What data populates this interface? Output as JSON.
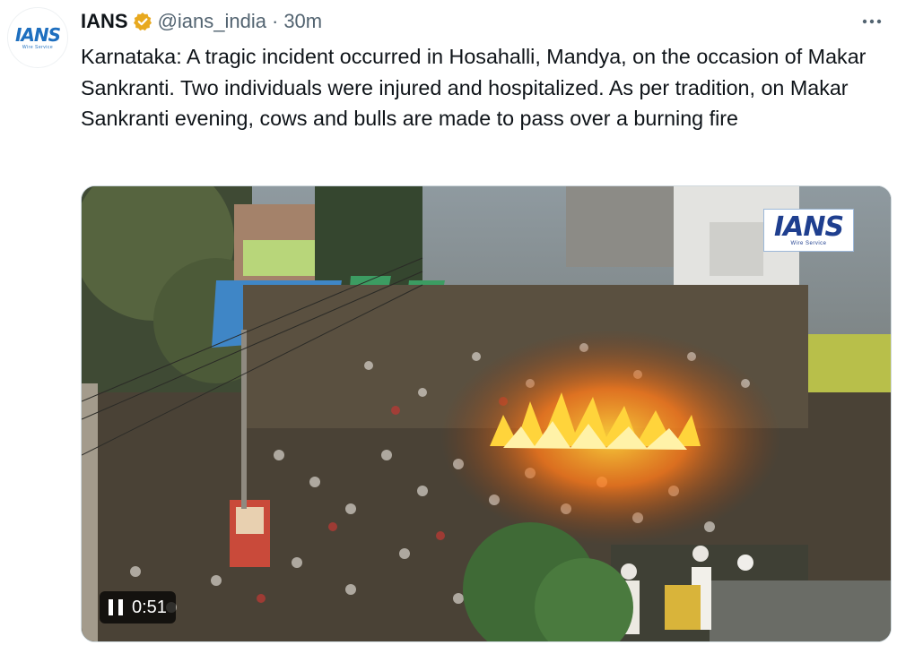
{
  "tweet": {
    "author_name": "IANS",
    "handle": "@ians_india",
    "separator": "·",
    "time": "30m",
    "text": "Karnataka: A tragic incident occurred in Hosahalli, Mandya, on the occasion of Makar Sankranti. Two individuals were injured and hospitalized. As per tradition, on Makar Sankranti evening, cows and bulls are made to pass over a burning fire",
    "more_label": "···"
  },
  "avatar": {
    "logo_text": "IANS",
    "logo_sub": "Wire Service"
  },
  "media": {
    "watermark_text": "IANS",
    "watermark_sub": "Wire Service",
    "player_time": "0:51"
  },
  "icons": {
    "verified": "verified-badge-icon",
    "more": "more-options-icon",
    "pause": "pause-icon"
  },
  "colors": {
    "verified": "#e8a91f",
    "handle": "#536471",
    "brand": "#1e6fbf"
  }
}
